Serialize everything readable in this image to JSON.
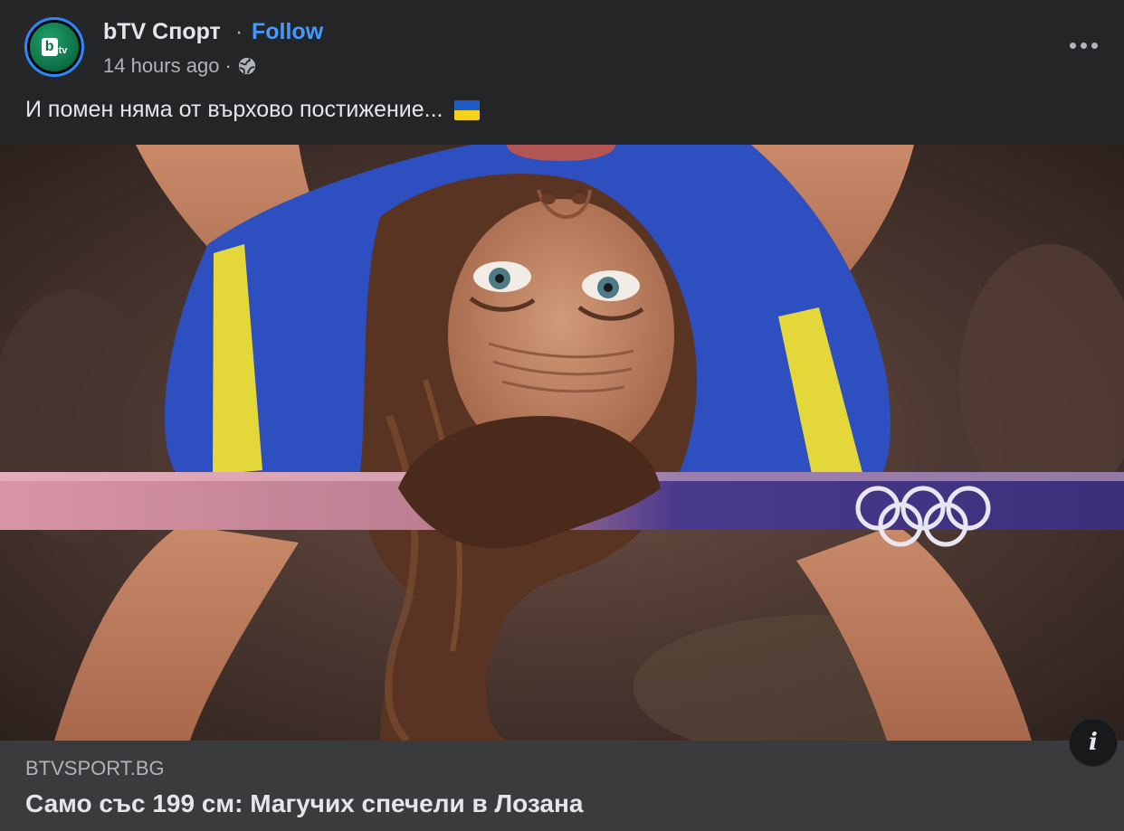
{
  "post": {
    "page_name": "bTV Спорт",
    "separator": "·",
    "follow_label": "Follow",
    "timestamp": "14 hours ago",
    "meta_separator": "·",
    "privacy_icon": "globe-icon",
    "more_icon": "more-options-icon",
    "text": "И помен няма от върхово постижение...",
    "text_emoji": "flag-ukraine"
  },
  "avatar": {
    "logo_b": "b",
    "logo_tv": "tv"
  },
  "link_preview": {
    "domain": "BTVSPORT.BG",
    "headline": "Само със 199 см: Магучих спечели в Лозана",
    "info_icon_glyph": "i"
  },
  "colors": {
    "background": "#242526",
    "link_card": "#3a3b3c",
    "accent": "#4599ff",
    "text_primary": "#e4e6eb",
    "text_secondary": "#b0b3b8"
  }
}
